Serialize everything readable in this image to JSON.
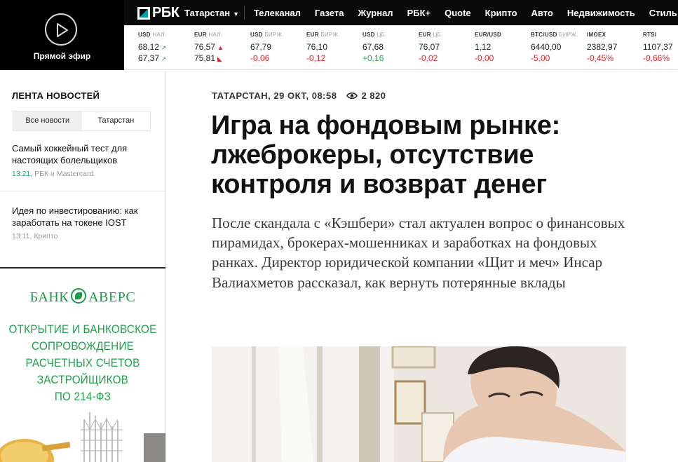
{
  "live": {
    "label": "Прямой эфир",
    "icon": "play-icon"
  },
  "header": {
    "logo": "РБК",
    "region": "Татарстан",
    "nav": [
      "Телеканал",
      "Газета",
      "Журнал",
      "РБК+",
      "Quote",
      "Крипто",
      "Авто",
      "Недвижимость",
      "Стиль"
    ]
  },
  "ticker": [
    {
      "cur": "USD",
      "src": "НАЛ.",
      "v1": "68,12",
      "v2": "67,37",
      "d1": "up",
      "d2": "up"
    },
    {
      "cur": "EUR",
      "src": "НАЛ.",
      "v1": "76,57",
      "v2": "75,81",
      "d1": "upred",
      "d2": "downred"
    },
    {
      "cur": "USD",
      "src": "БИРЖ.",
      "v1": "67,79",
      "v2": "-0,06",
      "c2": "down"
    },
    {
      "cur": "EUR",
      "src": "БИРЖ.",
      "v1": "76,10",
      "v2": "-0,12",
      "c2": "down"
    },
    {
      "cur": "USD",
      "src": "ЦБ.",
      "v1": "67,68",
      "v2": "+0,16",
      "c2": "up"
    },
    {
      "cur": "EUR",
      "src": "ЦБ.",
      "v1": "76,07",
      "v2": "-0,02",
      "c2": "down"
    },
    {
      "cur": "EUR/USD",
      "src": "",
      "v1": "1,12",
      "v2": "-0,00",
      "c2": "down"
    },
    {
      "cur": "BTC/USD",
      "src": "БИРЖ.",
      "v1": "6440,00",
      "v2": "-5,00",
      "c2": "down"
    },
    {
      "cur": "IMOEX",
      "src": "",
      "v1": "2382,97",
      "v2": "-0,45%",
      "c2": "down"
    },
    {
      "cur": "RTSI",
      "src": "",
      "v1": "1107,37",
      "v2": "-0,66%",
      "c2": "down"
    }
  ],
  "sidebar": {
    "title": "ЛЕНТА НОВОСТЕЙ",
    "tabs": [
      "Все новости",
      "Татарстан"
    ],
    "news": [
      {
        "title": "Самый хоккейный тест для настоящих болельщиков",
        "time": "13:21,",
        "source": "РБК и Mastercard"
      },
      {
        "title": "Идея по инвестированию: как заработать на токене IOST",
        "time": "13:11,",
        "source": "Крипто"
      }
    ]
  },
  "ad": {
    "bank_left": "БАНК",
    "bank_right": "АВЕРС",
    "lines": [
      "ОТКРЫТИЕ И БАНКОВСКОЕ",
      "СОПРОВОЖДЕНИЕ",
      "РАСЧЕТНЫХ СЧЕТОВ",
      "ЗАСТРОЙЩИКОВ",
      "ПО 214-ФЗ"
    ]
  },
  "article": {
    "meta": "ТАТАРСТАН, 29 ОКТ, 08:58",
    "views": "2 820",
    "headline": "Игра на фондовым рынке: лжеброкеры, отсутствие контроля и возврат денег",
    "lead": "После скандала с «Кэшбери» стал актуален вопрос о финансовых пирамидах, брокерах-мошенниках и заработках на фондовых ранках. Директор юридической компании «Щит и меч» Инсар Валиахметов рассказал, как вернуть потерянные вклады"
  },
  "colors": {
    "accent_green": "#1da84a",
    "down_red": "#e0262a",
    "ad_green": "#22a04c"
  }
}
